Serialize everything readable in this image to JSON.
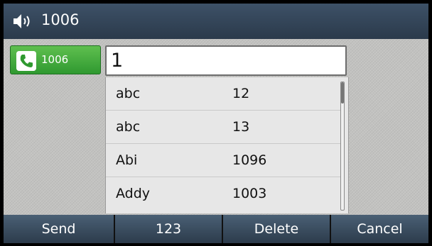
{
  "status_bar": {
    "title": "1006",
    "icon": "speaker-icon"
  },
  "line_key": {
    "label": "1006",
    "icon": "phone-handset-icon",
    "color": "#3aa83a"
  },
  "dial_input": {
    "value": "1"
  },
  "contacts": [
    {
      "name": "abc",
      "number": "12"
    },
    {
      "name": "abc",
      "number": "13"
    },
    {
      "name": "Abi",
      "number": "1096"
    },
    {
      "name": "Addy",
      "number": "1003"
    }
  ],
  "softkeys": [
    "Send",
    "123",
    "Delete",
    "Cancel"
  ]
}
